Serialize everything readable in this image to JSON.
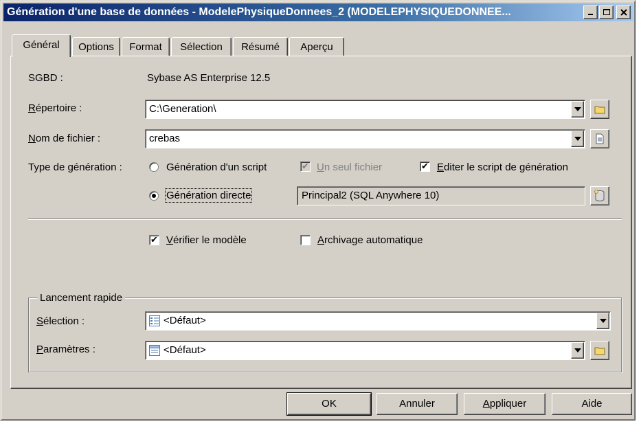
{
  "window": {
    "title": "Génération d'une base de données - ModelePhysiqueDonnees_2 (MODELEPHYSIQUEDONNEE..."
  },
  "tabs": [
    {
      "label": "Général"
    },
    {
      "label": "Options"
    },
    {
      "label": "Format"
    },
    {
      "label": "Sélection"
    },
    {
      "label": "Résumé"
    },
    {
      "label": "Aperçu"
    }
  ],
  "general": {
    "sgbd_label": "SGBD :",
    "sgbd_value": "Sybase AS Enterprise 12.5",
    "repertoire_label_key": "R",
    "repertoire_label_rest": "épertoire :",
    "repertoire_value": "C:\\Generation\\",
    "fichier_label_key": "N",
    "fichier_label_rest": "om de fichier :",
    "fichier_value": "crebas",
    "type_label_pre": "Type de ",
    "type_label_key": "g",
    "type_label_rest": "énération :",
    "radio_script": "Génération d'un script",
    "radio_script_selected": false,
    "un_seul_key": "U",
    "un_seul_rest": "n seul fichier",
    "un_seul_checked": true,
    "un_seul_enabled": false,
    "editer_key": "E",
    "editer_rest": "diter le script de génération",
    "editer_checked": true,
    "radio_directe": "Génération directe",
    "radio_directe_selected": true,
    "connection_value": "Principal2 (SQL Anywhere 10)",
    "verifier_key": "V",
    "verifier_rest": "érifier le modèle",
    "verifier_checked": true,
    "archivage_key": "A",
    "archivage_rest": "rchivage automatique",
    "archivage_checked": false
  },
  "lancement": {
    "legend": "Lancement rapide",
    "selection_key": "S",
    "selection_rest": "élection :",
    "selection_value": "<Défaut>",
    "parametres_key": "P",
    "parametres_rest": "aramètres :",
    "parametres_value": "<Défaut>"
  },
  "buttons": {
    "ok": "OK",
    "annuler": "Annuler",
    "appliquer_key": "A",
    "appliquer_rest": "ppliquer",
    "aide": "Aide"
  },
  "check_mark": "✔"
}
